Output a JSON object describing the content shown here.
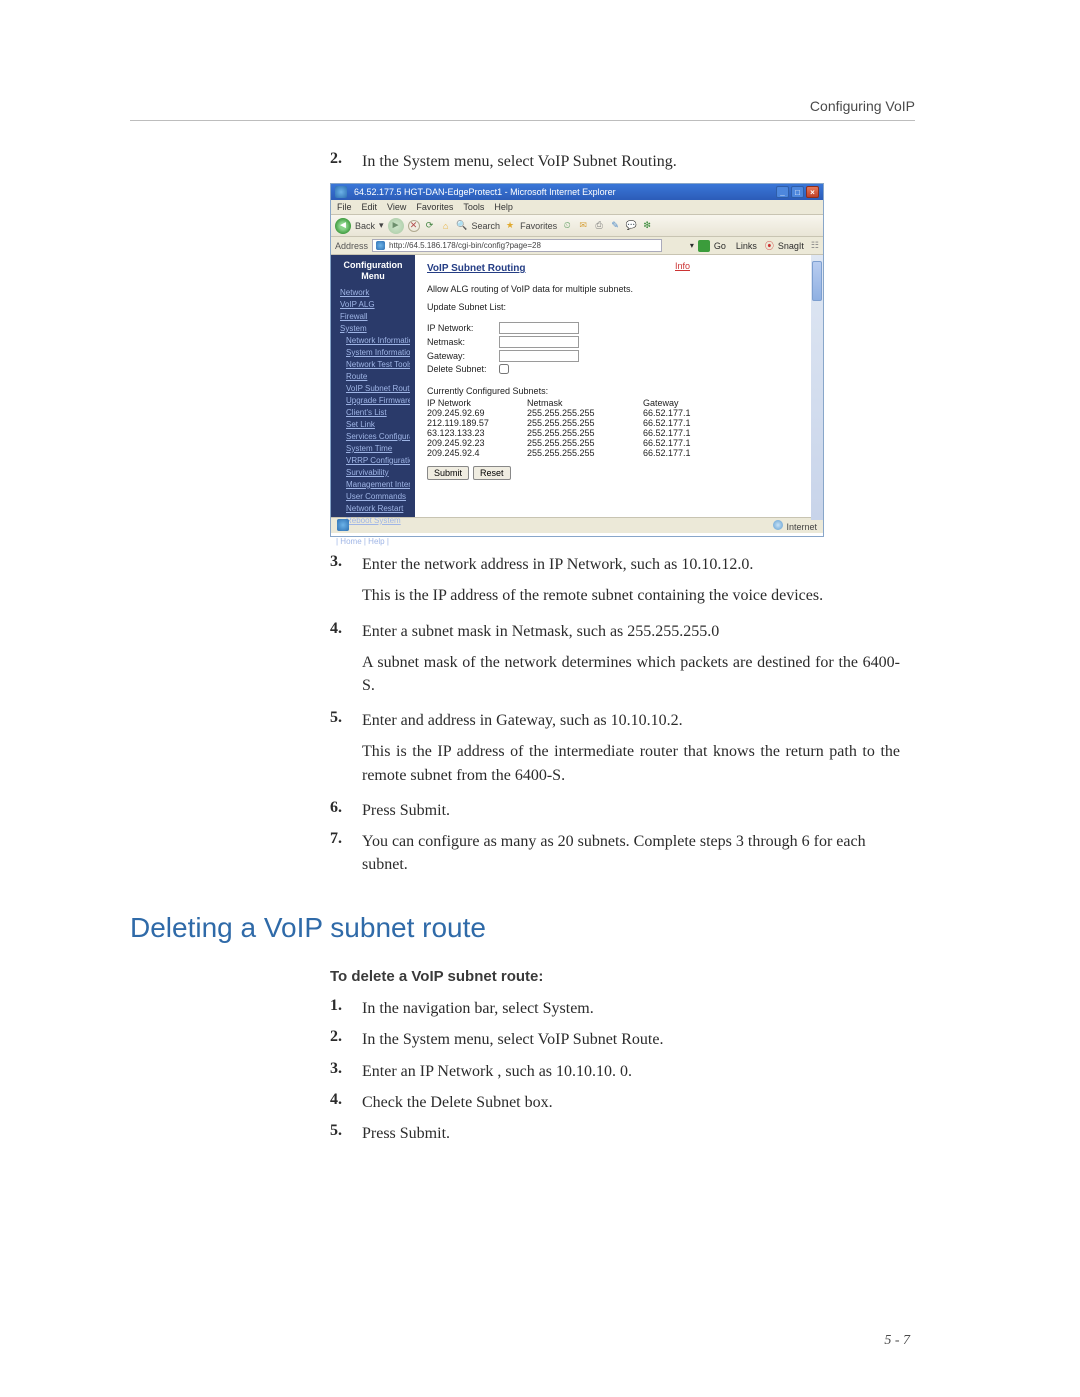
{
  "page": {
    "header_right": "Configuring VoIP",
    "page_number": "5 - 7"
  },
  "steps_first": [
    {
      "n": "2.",
      "t": "In the System menu, select VoIP Subnet Routing."
    },
    {
      "n": "3.",
      "t": "Enter the network address in IP Network, such as 10.10.12.0.",
      "sub": "This is the IP address of the remote subnet containing the voice devices."
    },
    {
      "n": "4.",
      "t": "Enter a subnet mask in Netmask, such as 255.255.255.0",
      "sub": "A subnet mask of the network determines which packets are destined for the 6400-S."
    },
    {
      "n": "5.",
      "t": "Enter and address in Gateway, such as 10.10.10.2.",
      "sub": "This is the IP address of the intermediate router that knows the return path to the remote subnet from the 6400-S."
    },
    {
      "n": "6.",
      "t": "Press Submit."
    },
    {
      "n": "7.",
      "t": "You can configure as many as 20 subnets. Complete steps 3 through 6 for each subnet."
    }
  ],
  "section_heading": "Deleting a VoIP subnet route",
  "sub_heading": "To delete a VoIP subnet route:",
  "steps_second": [
    {
      "n": "1.",
      "t": "In the navigation bar, select System."
    },
    {
      "n": "2.",
      "t": "In the System menu, select VoIP Subnet Route."
    },
    {
      "n": "3.",
      "t": "Enter an IP Network , such as 10.10.10. 0."
    },
    {
      "n": "4.",
      "t": "Check the Delete Subnet box."
    },
    {
      "n": "5.",
      "t": "Press Submit."
    }
  ],
  "browser": {
    "window_title": "64.52.177.5 HGT-DAN-EdgeProtect1 - Microsoft Internet Explorer",
    "menus": [
      "File",
      "Edit",
      "View",
      "Favorites",
      "Tools",
      "Help"
    ],
    "back_label": "Back",
    "search_label": "Search",
    "fav_label": "Favorites",
    "address_label": "Address",
    "address_value": "http://64.5.186.178/cgi-bin/config?page=28",
    "go_label": "Go",
    "links_label": "Links",
    "snagit_label": "SnagIt",
    "status_left": "",
    "status_right": "Internet"
  },
  "sidebar": {
    "heading": "Configuration Menu",
    "items": [
      "Network",
      "VoIP ALG",
      "Firewall",
      "System",
      "Network Information",
      "System Information",
      "Network Test Tools",
      "Route",
      "VoIP Subnet Routing",
      "Upgrade Firmware",
      "Client's List",
      "Set Link",
      "Services Configuration",
      "System Time",
      "VRRP Configuration",
      "Survivability",
      "Management Interface",
      "User Commands",
      "Network Restart",
      "Reboot System"
    ],
    "footer": "| Home | Help |"
  },
  "mainpane": {
    "title": "VoIP Subnet Routing",
    "info": "Info",
    "desc": "Allow ALG routing of VoIP data for multiple subnets.",
    "update_label": "Update Subnet List:",
    "labels": {
      "ip": "IP Network:",
      "nm": "Netmask:",
      "gw": "Gateway:",
      "del": "Delete Subnet:"
    },
    "configured_label": "Currently Configured Subnets:",
    "columns": [
      "IP Network",
      "Netmask",
      "Gateway"
    ],
    "rows": [
      [
        "209.245.92.69",
        "255.255.255.255",
        "66.52.177.1"
      ],
      [
        "212.119.189.57",
        "255.255.255.255",
        "66.52.177.1"
      ],
      [
        "63.123.133.23",
        "255.255.255.255",
        "66.52.177.1"
      ],
      [
        "209.245.92.23",
        "255.255.255.255",
        "66.52.177.1"
      ],
      [
        "209.245.92.4",
        "255.255.255.255",
        "66.52.177.1"
      ]
    ],
    "submit": "Submit",
    "reset": "Reset"
  }
}
